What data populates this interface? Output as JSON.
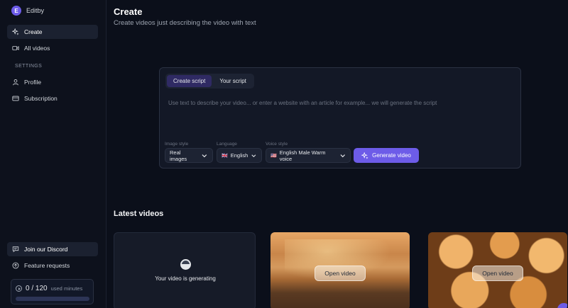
{
  "brand": {
    "initial": "E",
    "name": "Editby"
  },
  "sidebar": {
    "nav": [
      {
        "label": "Create",
        "icon": "sparkles-icon",
        "active": true
      },
      {
        "label": "All videos",
        "icon": "video-icon",
        "active": false
      }
    ],
    "settings_label": "SETTINGS",
    "settings": [
      {
        "label": "Profile",
        "icon": "user-icon"
      },
      {
        "label": "Subscription",
        "icon": "credit-card-icon"
      }
    ],
    "footer": [
      {
        "label": "Join our Discord",
        "icon": "chat-icon",
        "highlighted": true
      },
      {
        "label": "Feature requests",
        "icon": "arrow-up-circle-icon",
        "highlighted": false
      }
    ],
    "usage": {
      "count": "0 / 120",
      "unit": "used minutes",
      "fraction": 0.0
    }
  },
  "header": {
    "title": "Create",
    "subtitle": "Create videos just describing the video with text"
  },
  "create_card": {
    "tabs": [
      {
        "label": "Create script",
        "active": true
      },
      {
        "label": "Your script",
        "active": false
      }
    ],
    "prompt_placeholder": "Use text to describe your video... or enter a website with an article for example... we will generate the script",
    "image_style": {
      "label": "Image style",
      "value": "Real images"
    },
    "language": {
      "label": "Language",
      "flag": "🇬🇧",
      "value": "English"
    },
    "voice_style": {
      "label": "Voice style",
      "flag": "🇺🇸",
      "value": "English Male Warm voice"
    },
    "generate_label": "Generate video"
  },
  "latest": {
    "title": "Latest videos",
    "generating_text": "Your video is generating",
    "open_label": "Open video"
  },
  "colors": {
    "accent": "#6d5ce8",
    "background": "#0b0f1a",
    "card": "#131826"
  }
}
